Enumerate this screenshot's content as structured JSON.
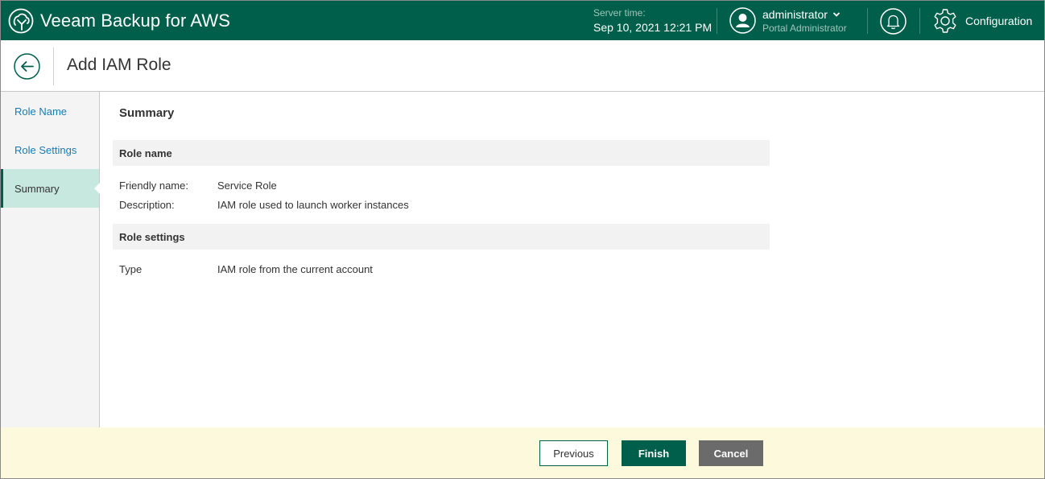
{
  "app": {
    "title": "Veeam Backup for AWS",
    "server_time_label": "Server time:",
    "server_time_value": "Sep 10, 2021 12:21 PM",
    "user_name": "administrator",
    "user_role": "Portal Administrator",
    "configuration_label": "Configuration"
  },
  "header": {
    "title": "Add IAM Role"
  },
  "sidebar": {
    "steps": [
      {
        "label": "Role Name"
      },
      {
        "label": "Role Settings"
      },
      {
        "label": "Summary"
      }
    ],
    "active_step": "Summary"
  },
  "main": {
    "section_title": "Summary",
    "groups": [
      {
        "title": "Role name",
        "rows": [
          {
            "key": "Friendly name:",
            "value": "Service Role"
          },
          {
            "key": "Description:",
            "value": "IAM role used to launch worker instances"
          }
        ]
      },
      {
        "title": "Role settings",
        "rows": [
          {
            "key": "Type",
            "value": "IAM role from the current account"
          }
        ]
      }
    ]
  },
  "footer": {
    "previous_label": "Previous",
    "finish_label": "Finish",
    "cancel_label": "Cancel"
  },
  "colors": {
    "brand_green": "#005f4b",
    "active_step_bg": "#c6e8de",
    "link_blue": "#1a7bb0",
    "footer_bg": "#fdf9dd",
    "cancel_gray": "#6b6b6b"
  },
  "icons": [
    "veeam-logo-icon",
    "user-avatar-icon",
    "chevron-down-icon",
    "bell-icon",
    "gear-icon",
    "back-arrow-icon"
  ]
}
